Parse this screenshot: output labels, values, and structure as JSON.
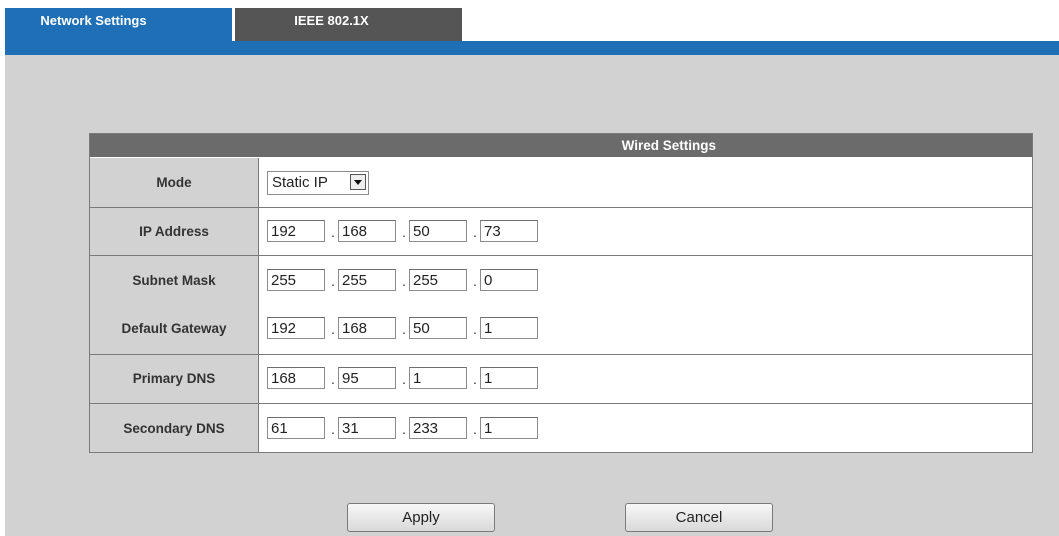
{
  "tabs": [
    {
      "label": "Network Settings",
      "active": true
    },
    {
      "label": "IEEE 802.1X",
      "active": false
    }
  ],
  "colors": {
    "accent": "#1e6fb6",
    "inactive_tab": "#555555",
    "header": "#6b6b6b",
    "background": "#d2d2d2"
  },
  "panel": {
    "title": "Wired Settings",
    "mode": {
      "label": "Mode",
      "value": "Static IP"
    },
    "rows": [
      {
        "label": "IP Address",
        "octets": [
          "192",
          "168",
          "50",
          "73"
        ]
      },
      {
        "label": "Subnet Mask",
        "octets": [
          "255",
          "255",
          "255",
          "0"
        ]
      },
      {
        "label": "Default Gateway",
        "octets": [
          "192",
          "168",
          "50",
          "1"
        ]
      },
      {
        "label": "Primary DNS",
        "octets": [
          "168",
          "95",
          "1",
          "1"
        ]
      },
      {
        "label": "Secondary DNS",
        "octets": [
          "61",
          "31",
          "233",
          "1"
        ]
      }
    ],
    "separator": "."
  },
  "buttons": {
    "apply": "Apply",
    "cancel": "Cancel"
  }
}
